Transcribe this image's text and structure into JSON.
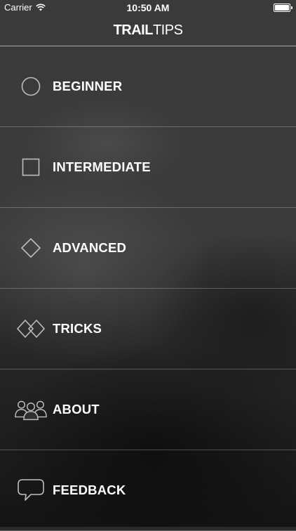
{
  "status_bar": {
    "carrier": "Carrier",
    "time": "10:50 AM"
  },
  "nav": {
    "brand_primary": "TRAIL",
    "brand_secondary": "TIPS"
  },
  "menu": {
    "items": [
      {
        "label": "BEGINNER",
        "icon": "circle-icon"
      },
      {
        "label": "INTERMEDIATE",
        "icon": "square-icon"
      },
      {
        "label": "ADVANCED",
        "icon": "diamond-icon"
      },
      {
        "label": "TRICKS",
        "icon": "double-diamond-icon"
      },
      {
        "label": "ABOUT",
        "icon": "people-icon"
      },
      {
        "label": "FEEDBACK",
        "icon": "speech-bubble-icon"
      }
    ]
  },
  "colors": {
    "text": "#ffffff",
    "divider": "rgba(255,255,255,0.25)"
  }
}
